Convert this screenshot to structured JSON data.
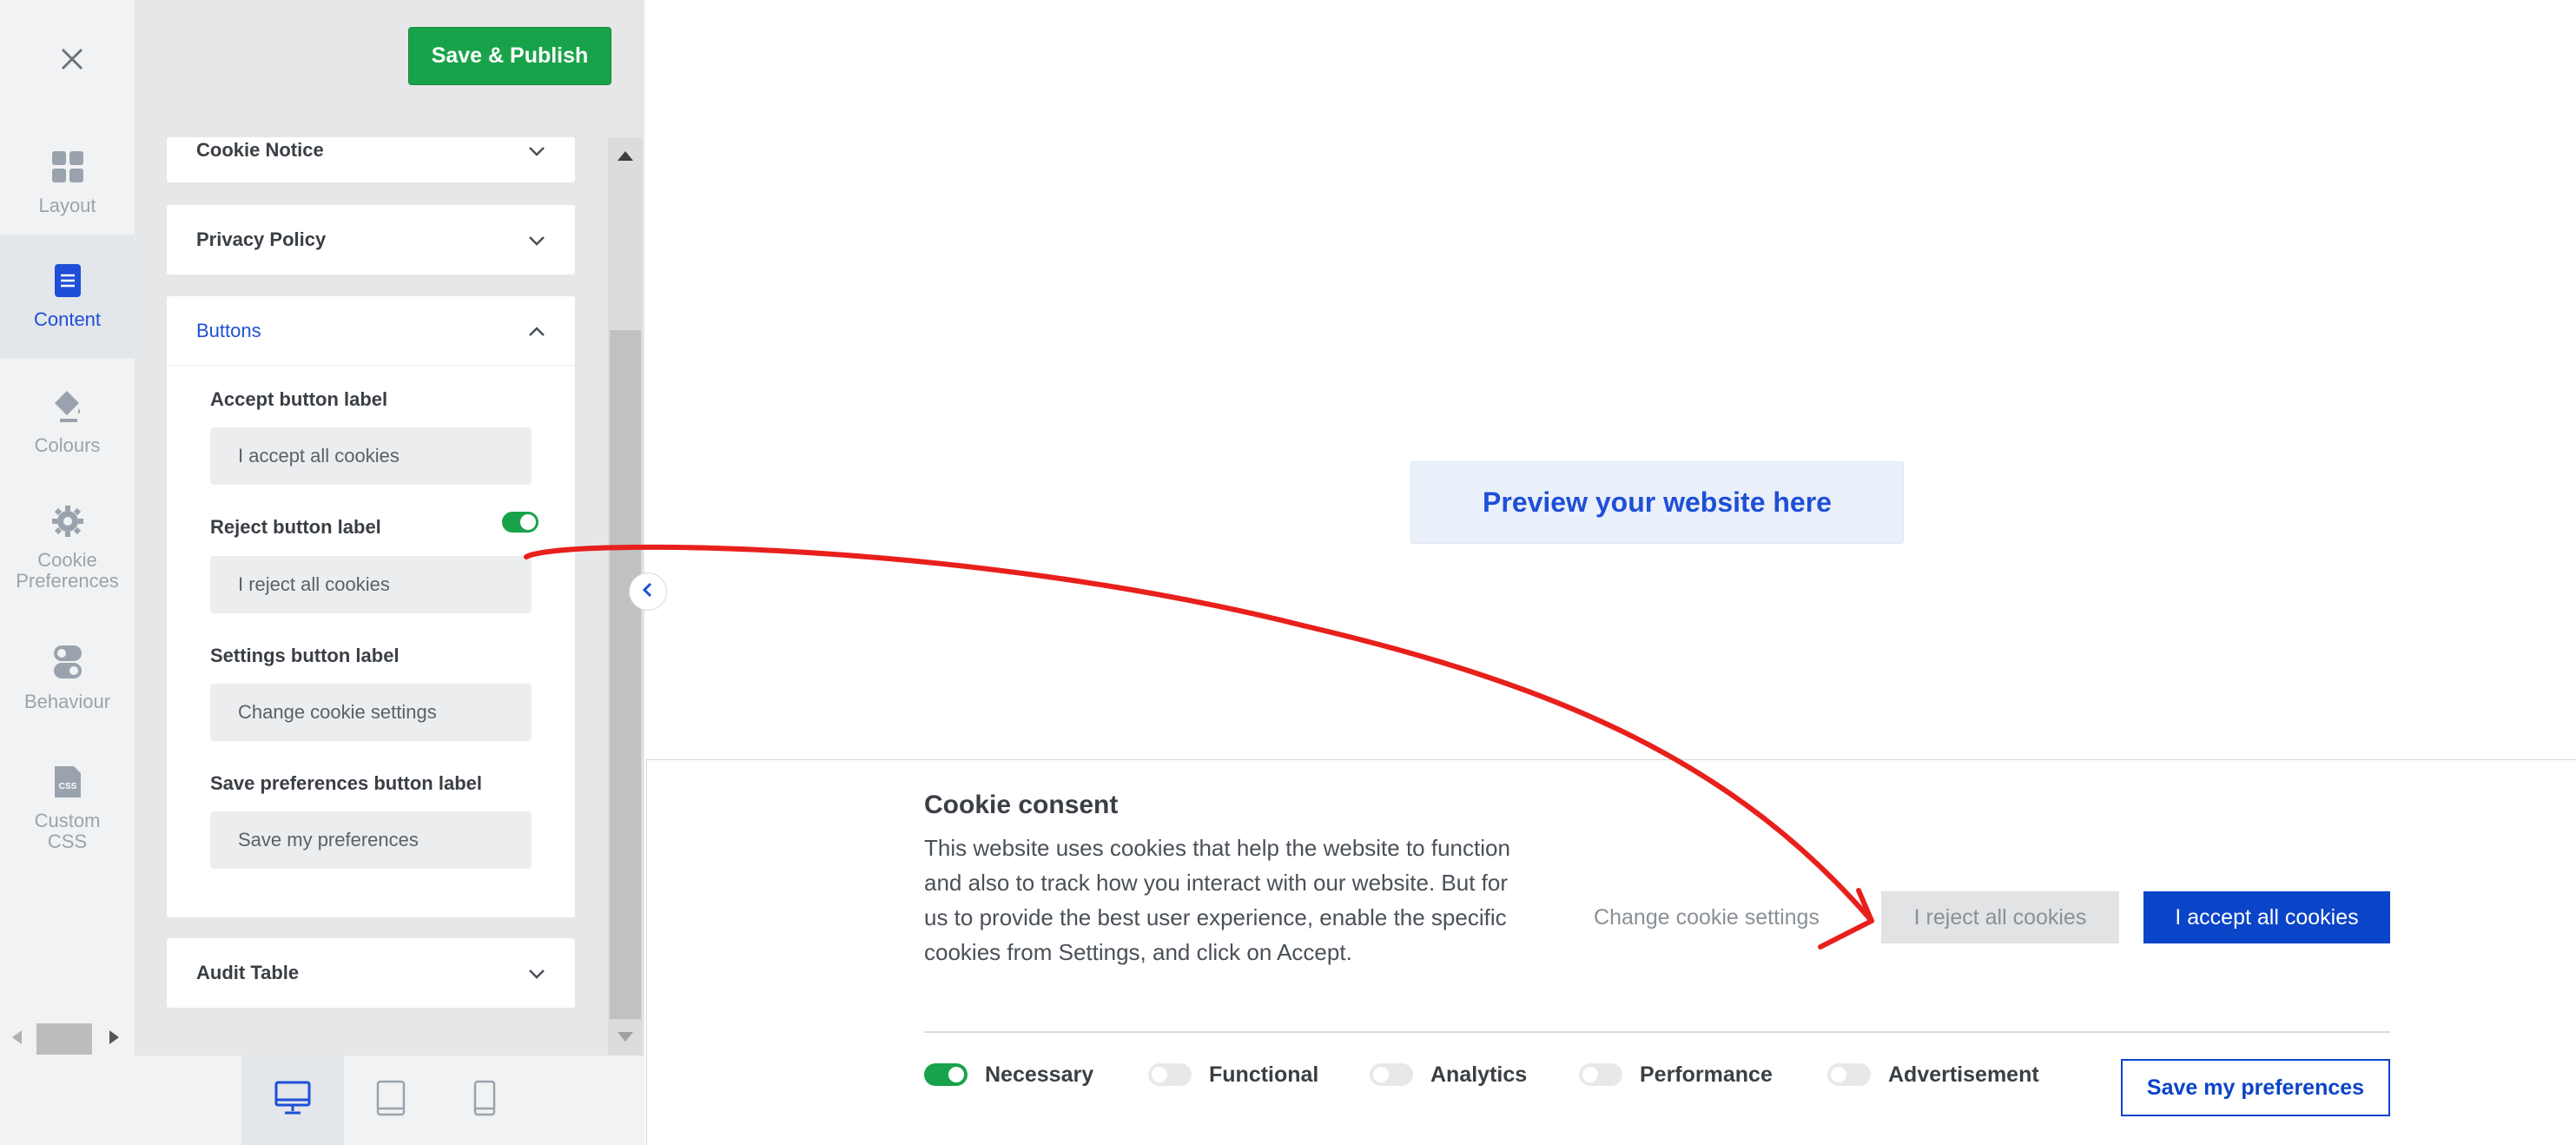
{
  "toolbar": {
    "publish_label": "Save & Publish"
  },
  "rail": {
    "items": [
      {
        "label": "Layout",
        "icon": "grid-icon"
      },
      {
        "label": "Content",
        "icon": "document-icon"
      },
      {
        "label": "Colours",
        "icon": "paint-bucket-icon"
      },
      {
        "label": "Cookie Preferences",
        "icon": "gear-icon"
      },
      {
        "label": "Behaviour",
        "icon": "toggle-icon"
      },
      {
        "label": "Custom CSS",
        "icon": "css-file-icon"
      }
    ],
    "active": "Content"
  },
  "panel": {
    "sections": {
      "cookie_notice": "Cookie Notice",
      "privacy_policy": "Privacy Policy",
      "buttons": "Buttons",
      "audit_table": "Audit Table"
    },
    "fields": {
      "accept_label": "Accept button label",
      "accept_value": "I accept all cookies",
      "reject_label": "Reject button label",
      "reject_value": "I reject all cookies",
      "reject_enabled": true,
      "settings_label": "Settings button label",
      "settings_value": "Change cookie settings",
      "save_label": "Save preferences button label",
      "save_value": "Save my preferences"
    }
  },
  "devices": [
    "desktop-icon",
    "tablet-icon",
    "mobile-icon"
  ],
  "preview": {
    "placeholder": "Preview your website here"
  },
  "banner": {
    "title": "Cookie consent",
    "text": "This website uses cookies that help the website to function and also to track how you interact with our website. But for us to provide the best user experience, enable the specific cookies from Settings, and click on Accept.",
    "settings_button": "Change cookie settings",
    "reject_button": "I reject all cookies",
    "accept_button": "I accept all cookies",
    "categories": [
      {
        "label": "Necessary",
        "on": true
      },
      {
        "label": "Functional",
        "on": false
      },
      {
        "label": "Analytics",
        "on": false
      },
      {
        "label": "Performance",
        "on": false
      },
      {
        "label": "Advertisement",
        "on": false
      }
    ],
    "save_button": "Save my preferences"
  },
  "colors": {
    "accent": "#1f4fd8",
    "publish": "#18a34a",
    "accept": "#0a44c8",
    "annotation": "#e8201c"
  }
}
